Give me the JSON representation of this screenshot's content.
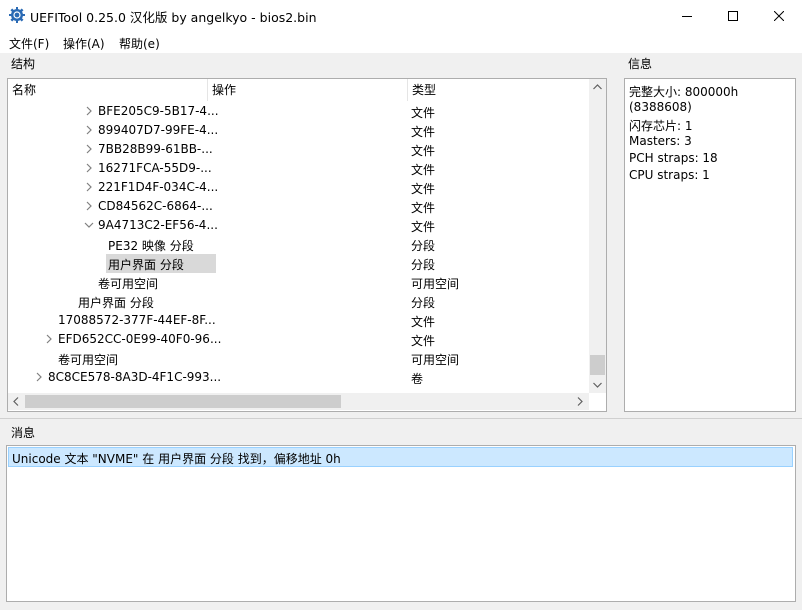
{
  "window": {
    "title": "UEFITool 0.25.0 汉化版 by angelkyo - bios2.bin"
  },
  "menu": [
    "文件(F)",
    "操作(A)",
    "帮助(e)"
  ],
  "structure": {
    "label": "结构",
    "columns": [
      "名称",
      "操作",
      "类型"
    ],
    "rows": [
      {
        "name": "BFE205C9-5B17-4...",
        "type": "文件",
        "expander": "collapsed"
      },
      {
        "name": "899407D7-99FE-4...",
        "type": "文件",
        "expander": "collapsed"
      },
      {
        "name": "7BB28B99-61BB-...",
        "type": "文件",
        "expander": "collapsed"
      },
      {
        "name": "16271FCA-55D9-...",
        "type": "文件",
        "expander": "collapsed"
      },
      {
        "name": "221F1D4F-034C-4...",
        "type": "文件",
        "expander": "collapsed"
      },
      {
        "name": "CD84562C-6864-...",
        "type": "文件",
        "expander": "collapsed"
      },
      {
        "name": "9A4713C2-EF56-4...",
        "type": "文件",
        "expander": "expanded"
      },
      {
        "name": "PE32 映像 分段",
        "type": "分段",
        "expander": "none"
      },
      {
        "name": "用户界面 分段",
        "type": "分段",
        "expander": "none",
        "selected": true
      },
      {
        "name": "卷可用空间",
        "type": "可用空间",
        "expander": "none"
      },
      {
        "name": "用户界面 分段",
        "type": "分段",
        "expander": "none"
      },
      {
        "name": "17088572-377F-44EF-8F...",
        "type": "文件",
        "expander": "none"
      },
      {
        "name": "EFD652CC-0E99-40F0-96...",
        "type": "文件",
        "expander": "collapsed"
      },
      {
        "name": "卷可用空间",
        "type": "可用空间",
        "expander": "none"
      },
      {
        "name": "8C8CE578-8A3D-4F1C-993...",
        "type": "卷",
        "expander": "collapsed"
      }
    ]
  },
  "info": {
    "label": "信息",
    "lines": [
      "完整大小: 800000h",
      "(8388608)",
      "闪存芯片: 1",
      "Masters: 3",
      "PCH straps: 18",
      "CPU straps: 1"
    ]
  },
  "messages": {
    "label": "消息",
    "items": [
      "Unicode 文本 \"NVME\" 在 用户界面 分段 找到，偏移地址 0h"
    ]
  },
  "colors": {
    "selection": "#cce8ff",
    "tree_selection": "#d9d9d9",
    "icon_blue": "#2a6ab4"
  },
  "icons": {
    "app": "uefi-gear-icon",
    "minimize": "minimize-icon",
    "maximize": "maximize-icon",
    "close": "close-icon"
  }
}
